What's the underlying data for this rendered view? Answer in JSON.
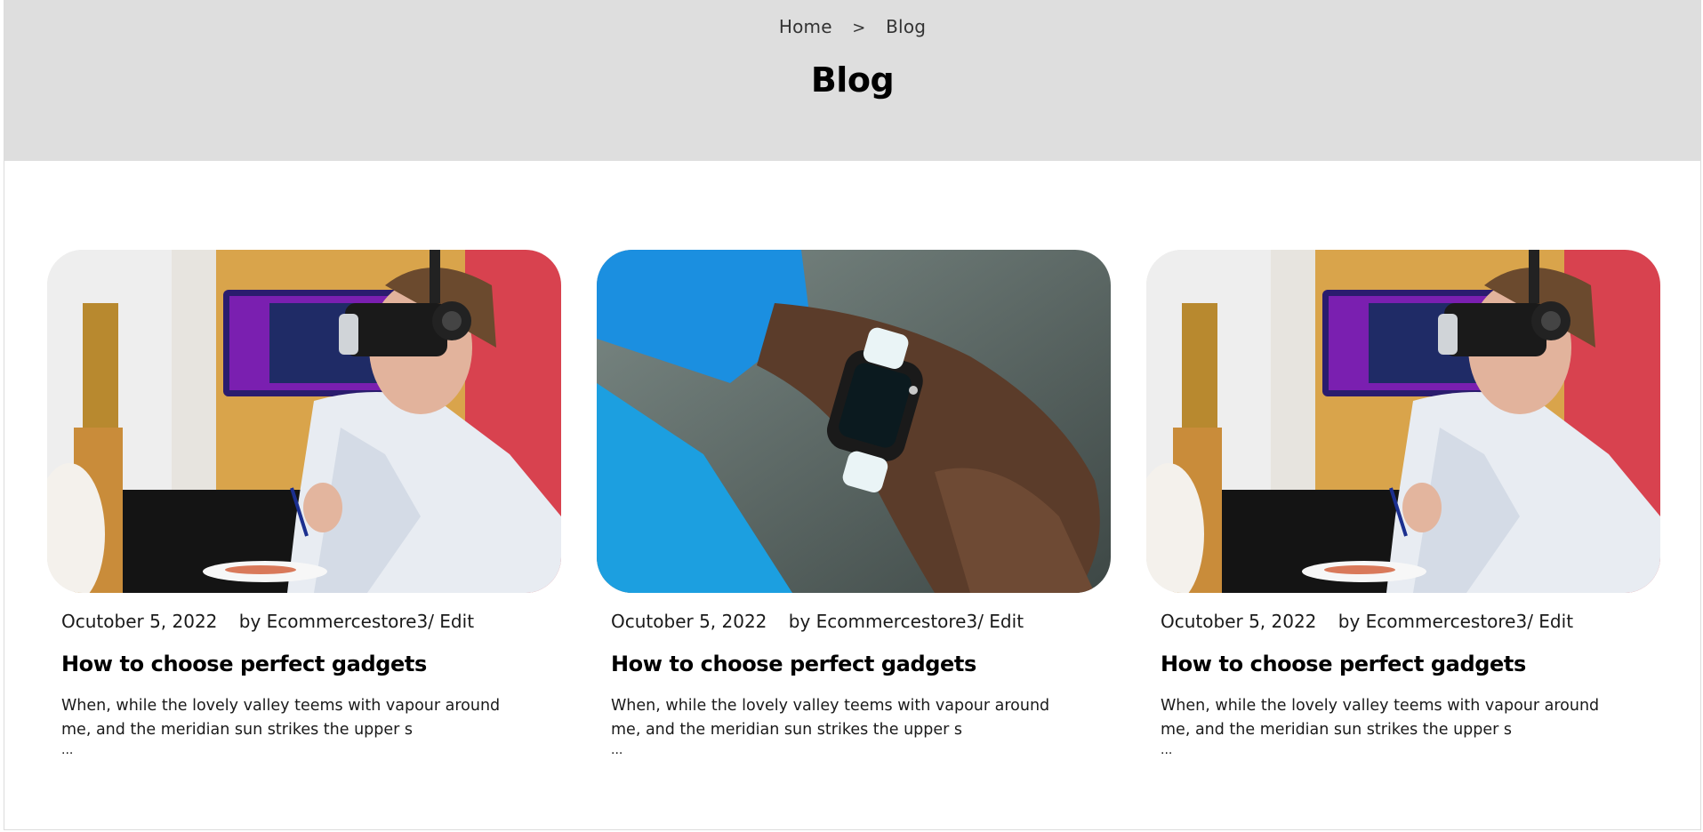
{
  "breadcrumb": {
    "home": "Home",
    "separator": ">",
    "current": "Blog"
  },
  "page": {
    "title": "Blog"
  },
  "posts": [
    {
      "image": "vr-headset-painter-photo",
      "date": "Ocutober 5, 2022",
      "author": "by Ecommercestore3",
      "edit": "/ Edit",
      "title": "How to choose perfect gadgets",
      "excerpt": "When, while the lovely valley teems with vapour around me, and the meridian sun strikes the upper s",
      "ellipsis": "..."
    },
    {
      "image": "smartwatch-wrist-photo",
      "date": "Ocutober 5, 2022",
      "author": "by Ecommercestore3",
      "edit": "/ Edit",
      "title": "How to choose perfect gadgets",
      "excerpt": "When, while the lovely valley teems with vapour around me, and the meridian sun strikes the upper s",
      "ellipsis": "..."
    },
    {
      "image": "vr-headset-painter-photo",
      "date": "Ocutober 5, 2022",
      "author": "by Ecommercestore3",
      "edit": "/ Edit",
      "title": "How to choose perfect gadgets",
      "excerpt": "When, while the lovely valley teems with vapour around me, and the meridian sun strikes the upper s",
      "ellipsis": "..."
    }
  ],
  "colors": {
    "hero_bg": "#dedede",
    "text": "#1a1a1a",
    "title": "#000000"
  }
}
